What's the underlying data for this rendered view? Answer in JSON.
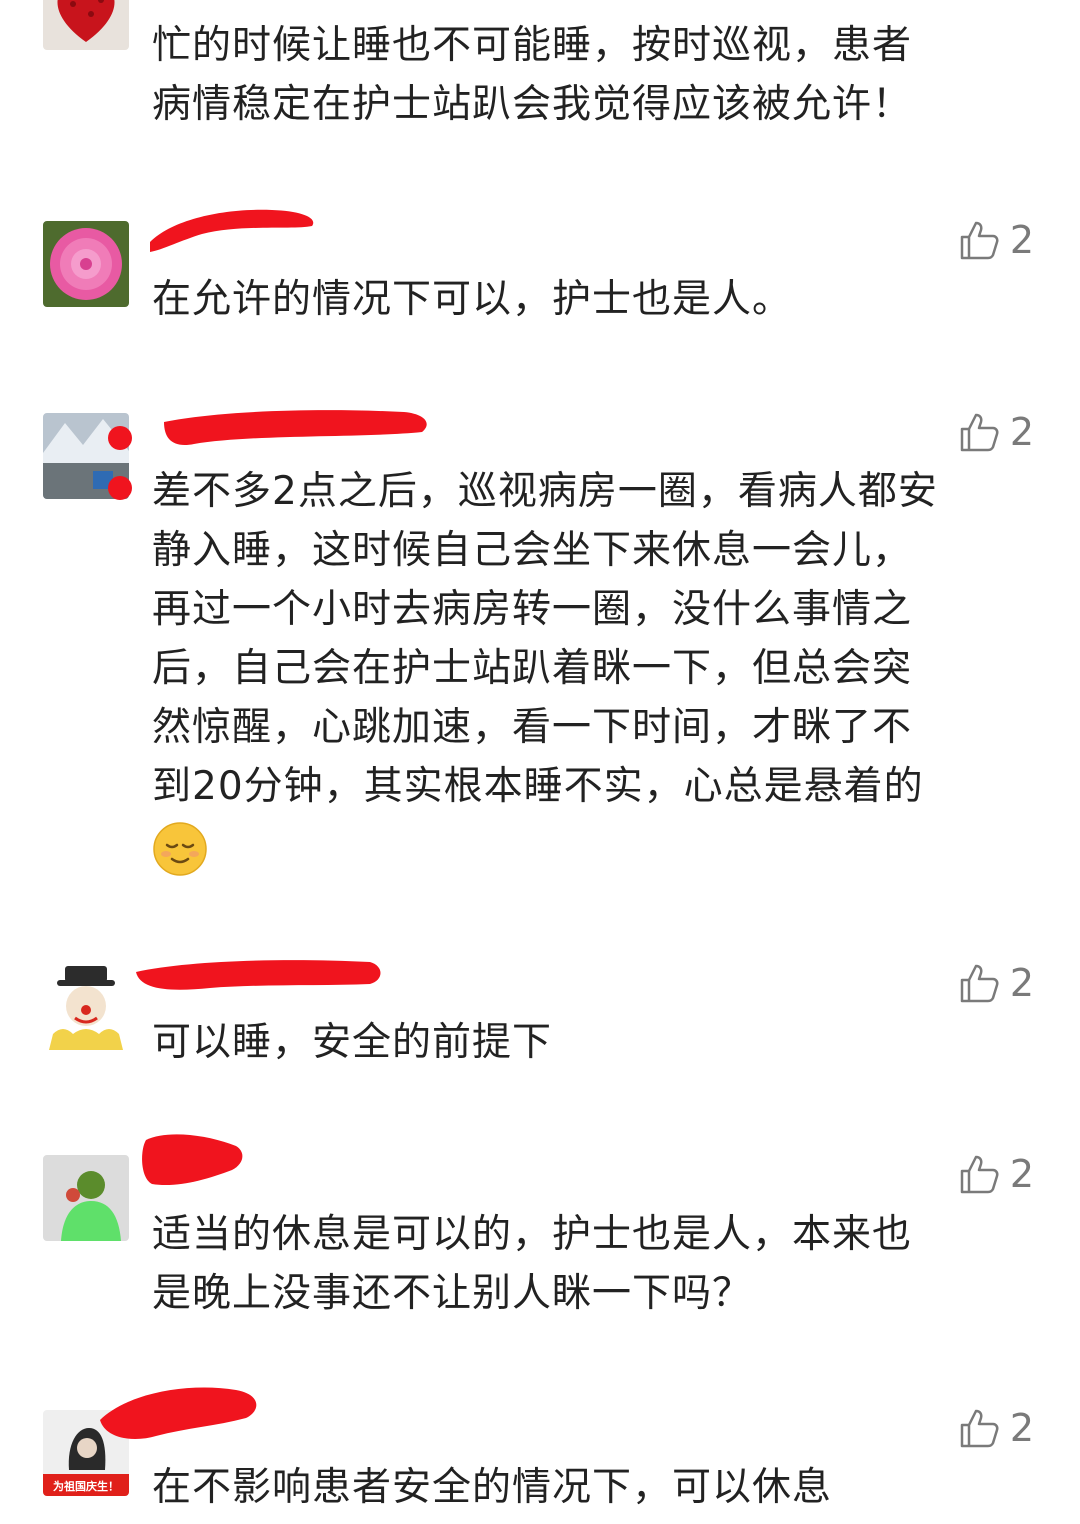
{
  "comments": [
    {
      "name": "",
      "text": "忙的时候让睡也不可能睡，按时巡视，患者\n病情稳定在护士站趴会我觉得应该被允许！",
      "likes": ""
    },
    {
      "name": "",
      "text": "在允许的情况下可以，护士也是人。",
      "likes": "2"
    },
    {
      "name": "",
      "text": "差不多2点之后，巡视病房一圈，看病人都安\n静入睡，这时候自己会坐下来休息一会儿，\n再过一个小时去病房转一圈，没什么事情之\n后，自己会在护士站趴着眯一下，但总会突\n然惊醒，心跳加速，看一下时间，才眯了不\n到20分钟，其实根本睡不实，心总是悬着的",
      "likes": "2",
      "emoji": "pensive-smile-emoji"
    },
    {
      "name": "",
      "text": "可以睡，安全的前提下",
      "likes": "2"
    },
    {
      "name": "",
      "text": "适当的休息是可以的，护士也是人，本来也\n是晚上没事还不让别人眯一下吗？",
      "likes": "2"
    },
    {
      "name": "",
      "avatar_caption": "为祖国庆生！",
      "text": "在不影响患者安全的情况下，可以休息",
      "likes": "2"
    }
  ],
  "icons": {
    "like": "thumbs-up-outline-icon"
  },
  "colors": {
    "redaction": "#f0141e",
    "text": "#222222",
    "secondary": "#7a7a7a"
  }
}
